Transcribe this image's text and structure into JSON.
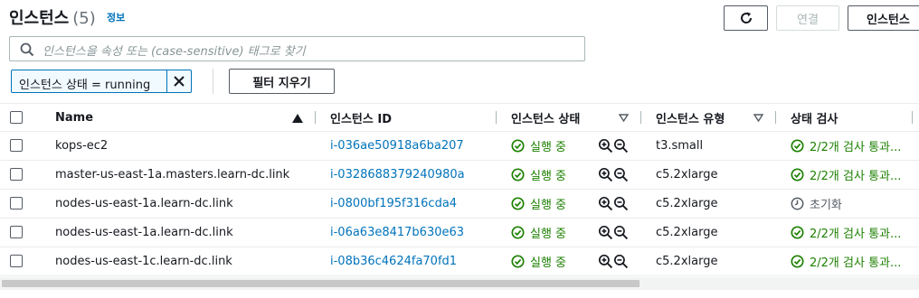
{
  "header": {
    "title": "인스턴스",
    "count": "(5)",
    "info_link": "정보",
    "connect_label": "연결",
    "state_label": "인스턴스"
  },
  "search": {
    "placeholder": "인스턴스을 속성 또는 (case-sensitive) 태그로 찾기"
  },
  "filter": {
    "token_label": "인스턴스 상태 = running",
    "clear_label": "필터 지우기"
  },
  "table": {
    "headers": {
      "name": "Name",
      "instance_id": "인스턴스 ID",
      "state": "인스턴스 상태",
      "type": "인스턴스 유형",
      "status_check": "상태 검사"
    },
    "rows": [
      {
        "name": "kops-ec2",
        "instance_id": "i-036ae50918a6ba207",
        "state": "실행 중",
        "type": "t3.small",
        "status_check": "2/2개 검사 통과..."
      },
      {
        "name": "master-us-east-1a.masters.learn-dc.link",
        "instance_id": "i-0328688379240980a",
        "state": "실행 중",
        "type": "c5.2xlarge",
        "status_check": "2/2개 검사 통과..."
      },
      {
        "name": "nodes-us-east-1a.learn-dc.link",
        "instance_id": "i-0800bf195f316cda4",
        "state": "실행 중",
        "type": "c5.2xlarge",
        "status_check": "초기화"
      },
      {
        "name": "nodes-us-east-1a.learn-dc.link",
        "instance_id": "i-06a63e8417b630e63",
        "state": "실행 중",
        "type": "c5.2xlarge",
        "status_check": "2/2개 검사 통과..."
      },
      {
        "name": "nodes-us-east-1c.learn-dc.link",
        "instance_id": "i-08b36c4624fa70fd1",
        "state": "실행 중",
        "type": "c5.2xlarge",
        "status_check": "2/2개 검사 통과..."
      }
    ]
  },
  "colors": {
    "link": "#0073bb",
    "success": "#1d8102",
    "text": "#16191f",
    "muted": "#545b64"
  },
  "icons": [
    "refresh-icon",
    "search-icon",
    "close-icon",
    "sort-ascending-icon",
    "filter-caret-icon",
    "success-check-icon",
    "zoom-in-icon",
    "zoom-out-icon",
    "clock-icon"
  ]
}
